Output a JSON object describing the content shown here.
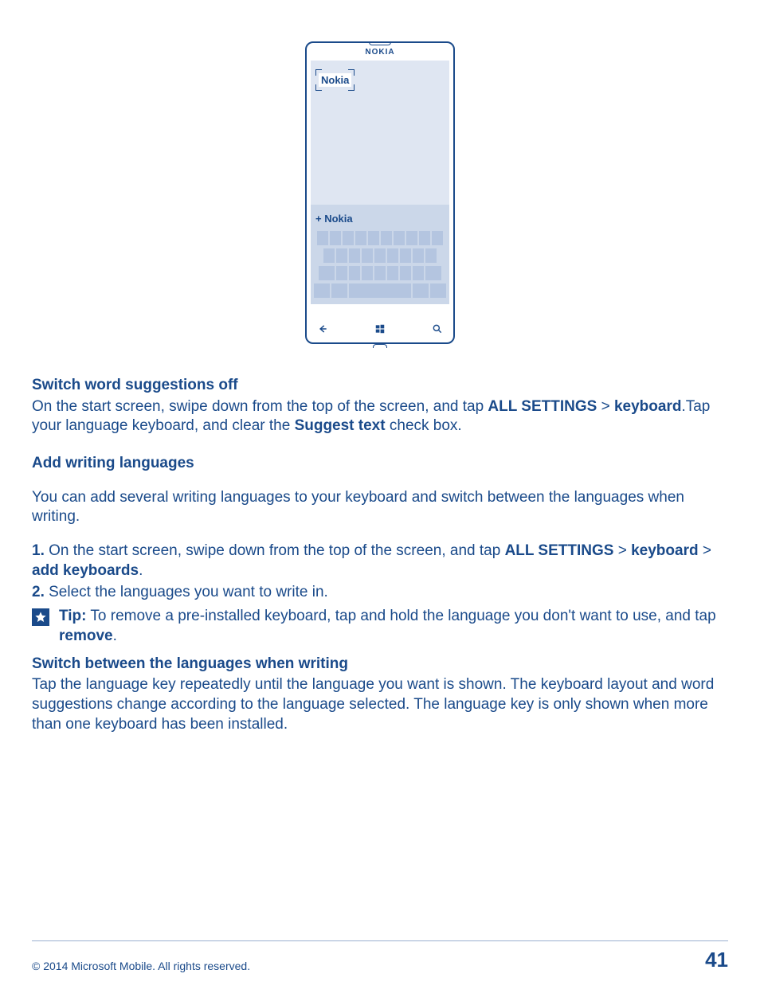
{
  "phone": {
    "brand": "NOKIA",
    "typed": "Nokia",
    "suggestion": "Nokia",
    "plus": "+"
  },
  "s1": {
    "heading": "Switch word suggestions off",
    "t1": "On the start screen, swipe down from the top of the screen, and tap ",
    "b1": "ALL SETTINGS",
    "sep": " > ",
    "b2": "keyboard",
    "t2": ".Tap your language keyboard, and clear the ",
    "b3": "Suggest text",
    "t3": " check box."
  },
  "s2": {
    "heading": "Add writing languages",
    "intro": "You can add several writing languages to your keyboard and switch between the languages when writing.",
    "n1": "1.",
    "t1": " On the start screen, swipe down from the top of the screen, and tap ",
    "b1": "ALL SETTINGS",
    "sep": " > ",
    "b2": "keyboard",
    "sep2": " > ",
    "b3": "add keyboards",
    "dot1": ".",
    "n2": "2.",
    "t2": " Select the languages you want to write in."
  },
  "tip": {
    "label": "Tip:",
    "t1": " To remove a pre-installed keyboard, tap and hold the language you don't want to use, and tap ",
    "b1": "remove",
    "dot": "."
  },
  "s3": {
    "heading": "Switch between the languages when writing",
    "body": "Tap the language key repeatedly until the language you want is shown. The keyboard layout and word suggestions change according to the language selected. The language key is only shown when more than one keyboard has been installed."
  },
  "footer": {
    "copyright": "© 2014 Microsoft Mobile. All rights reserved.",
    "page": "41"
  }
}
